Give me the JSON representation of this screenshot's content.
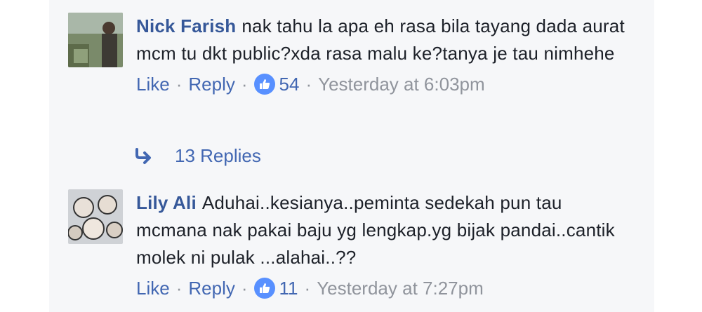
{
  "comments": [
    {
      "author": "Nick Farish",
      "text": "nak tahu la apa eh rasa bila tayang dada aurat mcm tu dkt public?xda rasa malu ke?tanya je tau nimhehe",
      "like_label": "Like",
      "reply_label": "Reply",
      "separator": "·",
      "reactions_count": "54",
      "timestamp": "Yesterday at 6:03pm"
    },
    {
      "author": "Lily Ali",
      "text": "Aduhai..kesianya..peminta sedekah pun tau mcmana nak pakai baju yg lengkap.yg bijak pandai..cantik molek ni pulak ...alahai..??",
      "like_label": "Like",
      "reply_label": "Reply",
      "separator": "·",
      "reactions_count": "11",
      "timestamp": "Yesterday at 7:27pm"
    }
  ],
  "replies_link": {
    "label": "13 Replies",
    "icon": "reply-arrow-icon"
  },
  "colors": {
    "link": "#4267b2",
    "author": "#365899",
    "meta": "#90949c",
    "like_badge": "#5890ff",
    "panel_bg": "#f6f7f9"
  }
}
